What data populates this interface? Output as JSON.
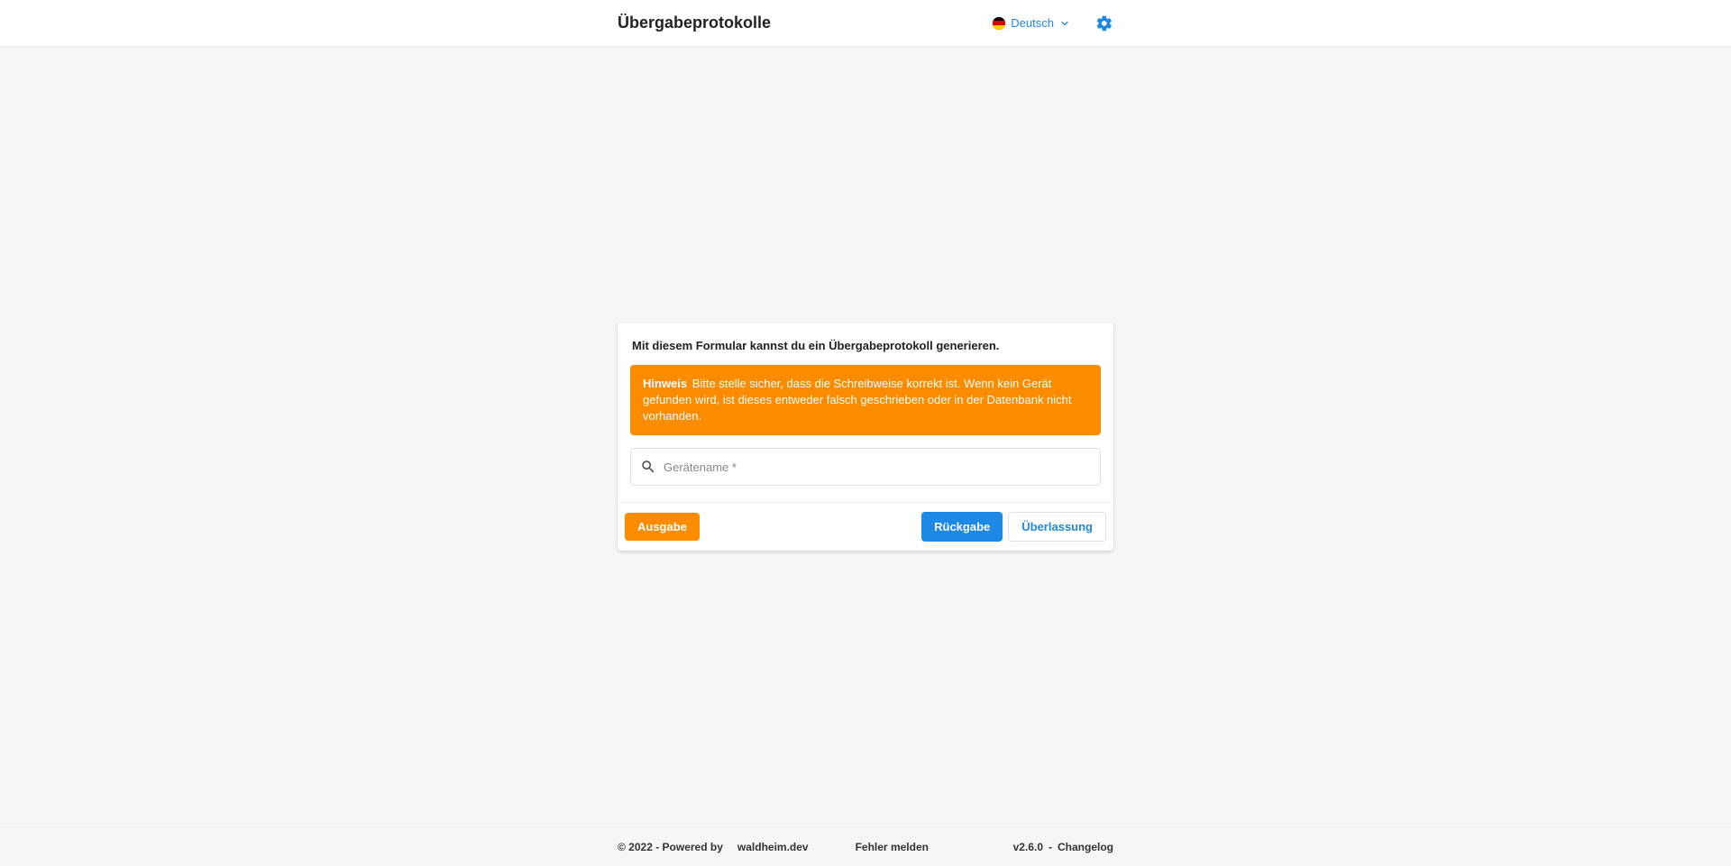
{
  "header": {
    "title": "Übergabeprotokolle",
    "language_label": "Deutsch"
  },
  "form": {
    "title": "Mit diesem Formular kannst du ein Übergabeprotokoll generieren.",
    "alert_strong": "Hinweis",
    "alert_text": "Bitte stelle sicher, dass die Schreibweise korrekt ist. Wenn kein Gerät gefunden wird, ist dieses entweder falsch geschrieben oder in der Datenbank nicht vorhanden.",
    "search_placeholder": "Gerätename *",
    "search_value": "",
    "actions": {
      "ausgabe": "Ausgabe",
      "rueckgabe": "Rückgabe",
      "ueberlassung": "Überlassung"
    }
  },
  "footer": {
    "copyright": "© 2022 - Powered by",
    "brand": "waldheim.dev",
    "report": "Fehler melden",
    "version": "v2.6.0",
    "sep": " - ",
    "changelog": "Changelog"
  }
}
